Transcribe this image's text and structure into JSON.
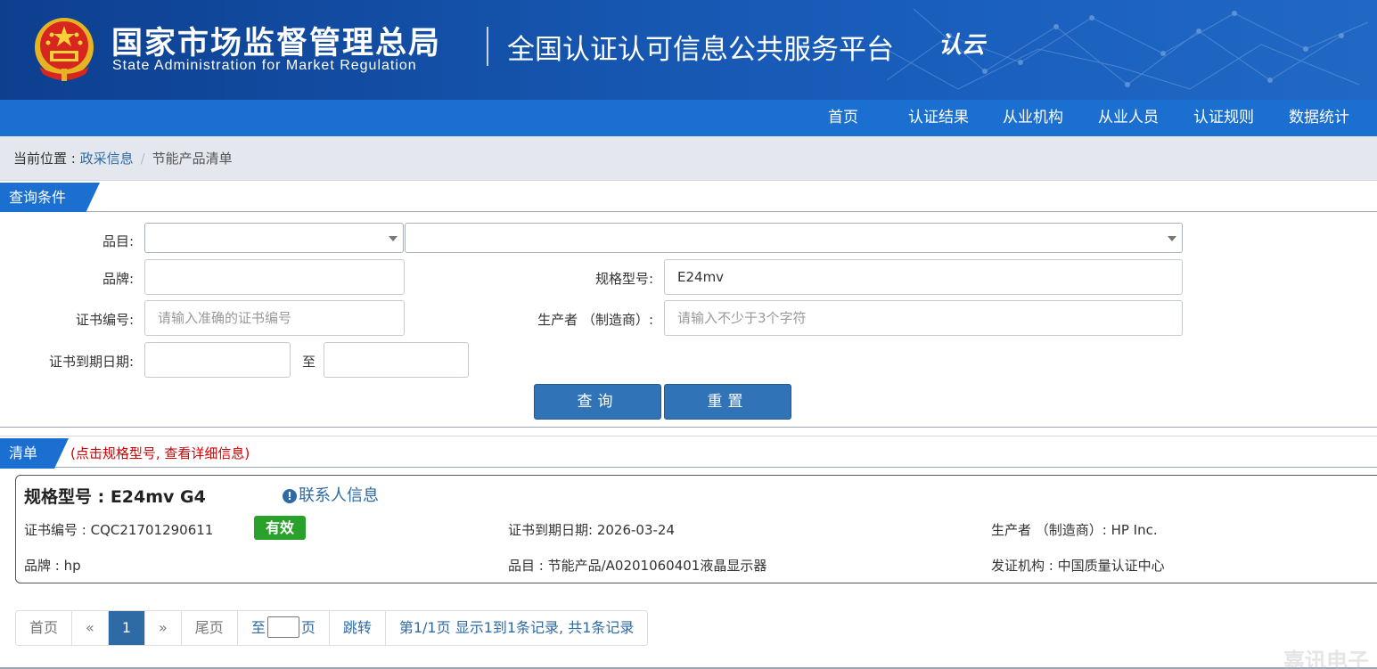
{
  "header": {
    "org_cn": "国家市场监督管理总局",
    "org_en": "State Administration  for  Market Regulation",
    "platform_title": "全国认证认可信息公共服务平台",
    "logo_text": "认云"
  },
  "nav": {
    "items": [
      "首页",
      "认证结果",
      "从业机构",
      "从业人员",
      "认证规则",
      "数据统计"
    ]
  },
  "breadcrumb": {
    "prefix": "当前位置 : ",
    "parent": "政采信息",
    "separator": "/",
    "current": "节能产品清单"
  },
  "query": {
    "section_title": "查询条件",
    "category_label": "品目:",
    "category_value": "",
    "subcategory_value": "",
    "brand_label": "品牌:",
    "brand_value": "",
    "model_label": "规格型号:",
    "model_value": "E24mv",
    "cert_no_label": "证书编号:",
    "cert_no_placeholder": "请输入准确的证书编号",
    "producer_label": "生产者 （制造商）:",
    "producer_placeholder": "请输入不少于3个字符",
    "expiry_label": "证书到期日期:",
    "expiry_to": "至",
    "expiry_from_value": "",
    "expiry_end_value": "",
    "search_button": "查询",
    "reset_button": "重置"
  },
  "list": {
    "section_title": "清单",
    "note": "(点击规格型号, 查看详细信息)",
    "records": [
      {
        "model_label": "规格型号 : ",
        "model": "E24mv G4",
        "contact_icon": "!",
        "contact_link": "联系人信息",
        "cert_no_label": "证书编号 : ",
        "cert_no": "CQC21701290611",
        "status": "有效",
        "status_color": "#2aa12a",
        "expiry_label": "证书到期日期: ",
        "expiry": "2026-03-24",
        "producer_label": "生产者 （制造商）: ",
        "producer": "HP Inc.",
        "brand_label": "品牌 : ",
        "brand": "hp",
        "category_label": "品目 : ",
        "category": "节能产品/A0201060401液晶显示器",
        "issuer_label": "发证机构 : ",
        "issuer": "中国质量认证中心"
      }
    ]
  },
  "pagination": {
    "first": "首页",
    "prev": "«",
    "current_page": "1",
    "next": "»",
    "last": "尾页",
    "goto_prefix": "至",
    "goto_suffix": "页",
    "jump": "跳转",
    "summary": "第1/1页  显示1到1条记录, 共1条记录"
  },
  "watermark": "嘉讯电子",
  "colors": {
    "header_bg": "#1656b0",
    "nav_bg": "#1a6fd0",
    "button_bg": "#3074b7",
    "link": "#2d6aa6",
    "note_red": "#d40000"
  }
}
